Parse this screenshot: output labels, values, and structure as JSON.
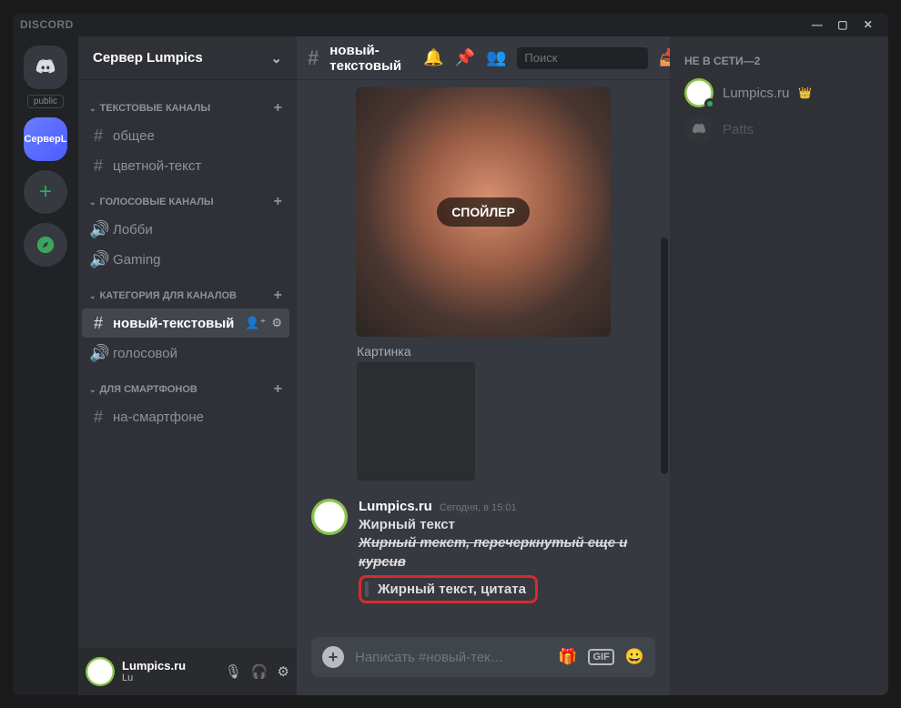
{
  "titlebar": {
    "brand": "DISCORD"
  },
  "window_controls": {
    "min": "—",
    "max": "▢",
    "close": "✕"
  },
  "guilds": {
    "public_tag": "public",
    "selected_label": "СерверL"
  },
  "server": {
    "name": "Сервер Lumpics"
  },
  "categories": [
    {
      "name": "ТЕКСТОВЫЕ КАНАЛЫ",
      "channels": [
        {
          "type": "text",
          "name": "общее"
        },
        {
          "type": "text",
          "name": "цветной-текст"
        }
      ]
    },
    {
      "name": "ГОЛОСОВЫЕ КАНАЛЫ",
      "channels": [
        {
          "type": "voice",
          "name": "Лобби"
        },
        {
          "type": "voice",
          "name": "Gaming"
        }
      ]
    },
    {
      "name": "КАТЕГОРИЯ ДЛЯ КАНАЛОВ",
      "channels": [
        {
          "type": "text",
          "name": "новый-текстовый",
          "selected": true
        },
        {
          "type": "voice",
          "name": "голосовой"
        }
      ]
    },
    {
      "name": "ДЛЯ СМАРТФОНОВ",
      "channels": [
        {
          "type": "text",
          "name": "на-смартфоне"
        }
      ]
    }
  ],
  "user": {
    "name": "Lumpics.ru",
    "disc": "Lu"
  },
  "toolbar": {
    "channel": "новый-текстовый",
    "search_placeholder": "Поиск"
  },
  "spoiler_btn": "СПОЙЛЕР",
  "attachment_label": "Картинка",
  "message": {
    "author": "Lumpics.ru",
    "timestamp": "Сегодня, в 15:01",
    "line_bold": "Жирный текст",
    "line_strike": "Жирный текст, перечеркнутый еще и курсив",
    "quote": "Жирный текст, цитата"
  },
  "composer": {
    "placeholder": "Написать #новый-тек…"
  },
  "members": {
    "header": "НЕ В СЕТИ—2",
    "list": [
      {
        "name": "Lumpics.ru",
        "owner": true
      },
      {
        "name": "Patts",
        "offline": true
      }
    ]
  }
}
